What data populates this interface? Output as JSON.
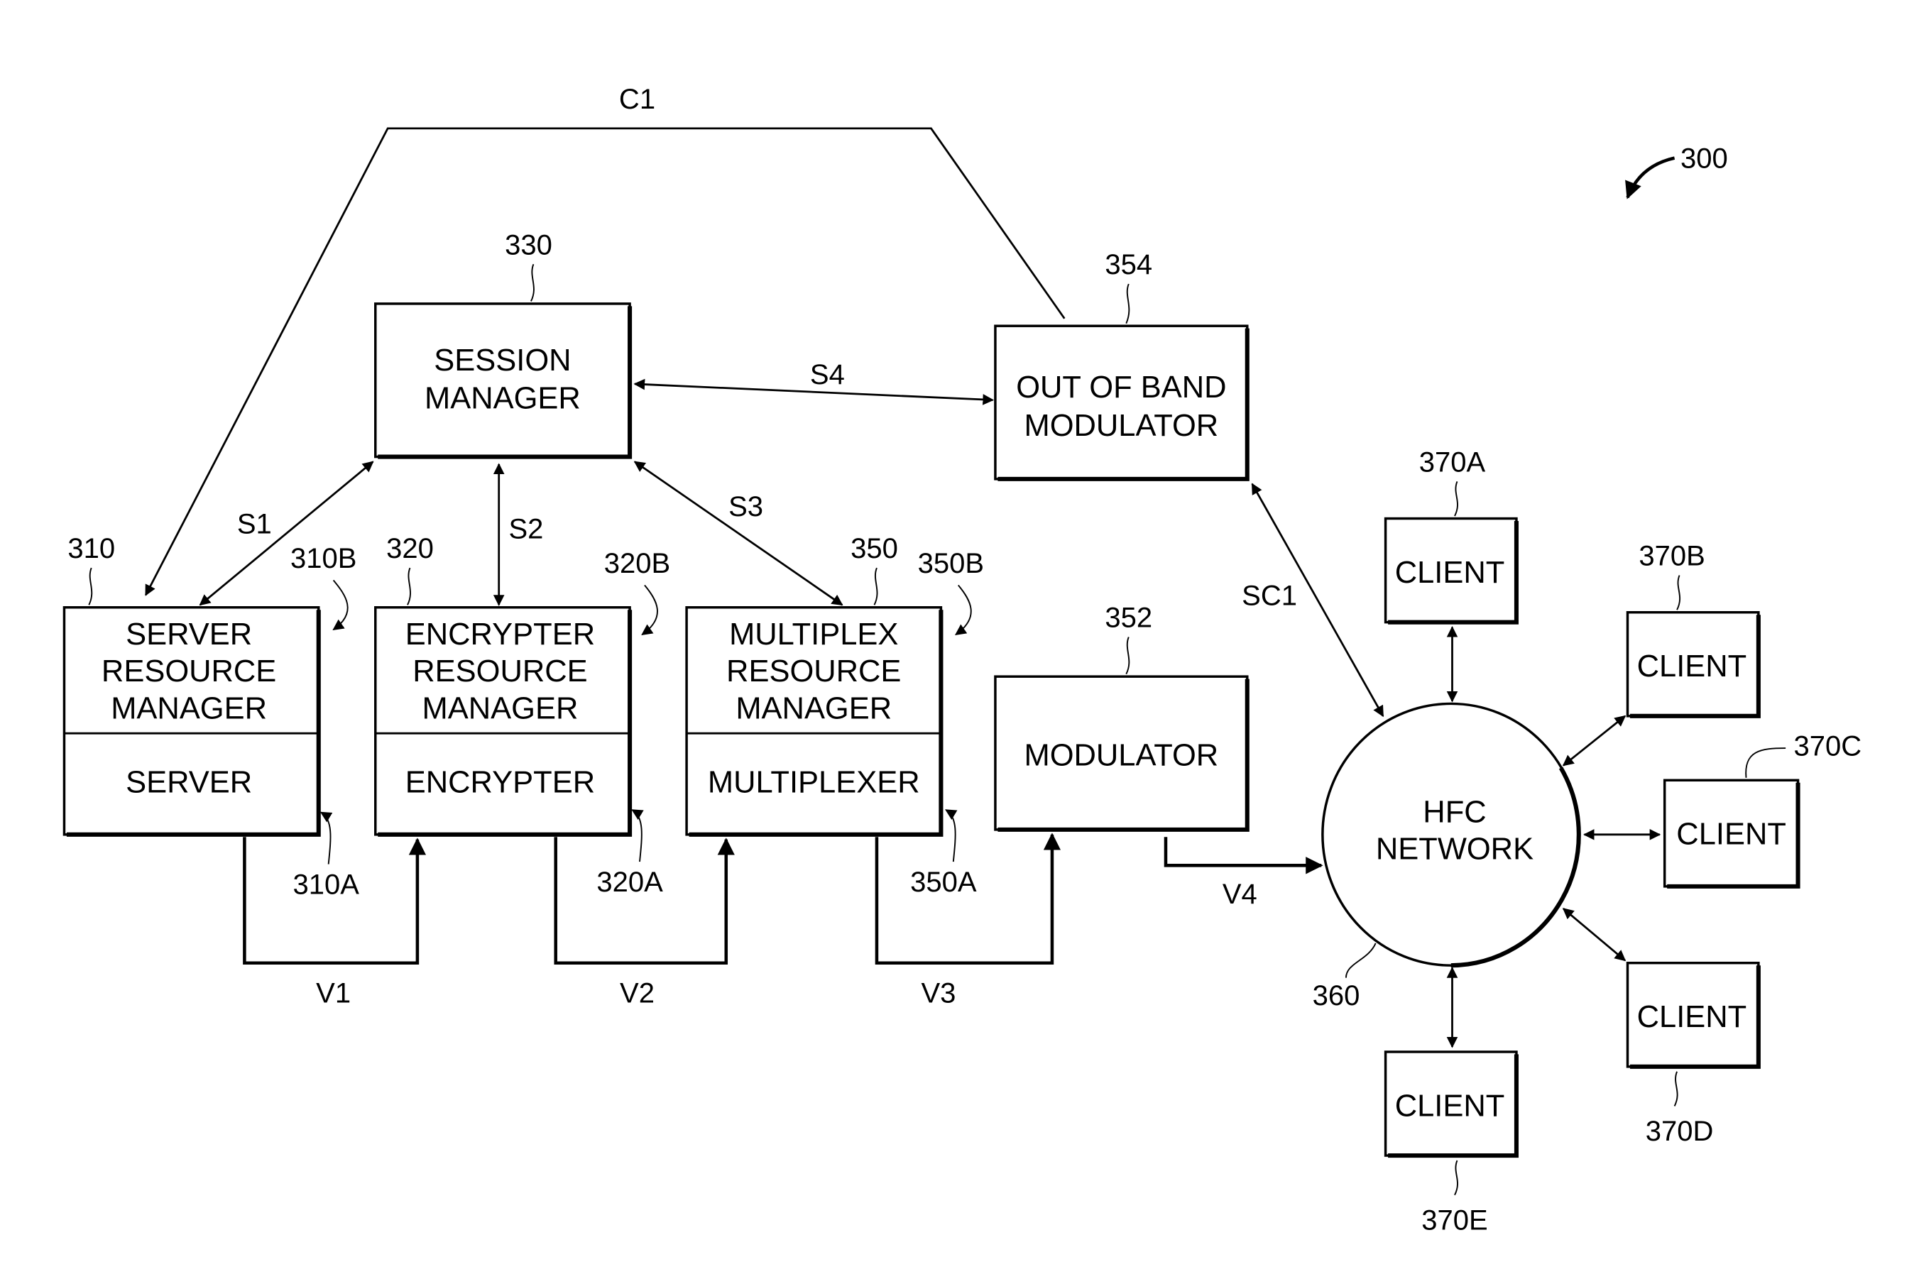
{
  "figure": {
    "ref": "300",
    "connections": {
      "c1": "C1",
      "s1": "S1",
      "s2": "S2",
      "s3": "S3",
      "s4": "S4",
      "sc1": "SC1",
      "v1": "V1",
      "v2": "V2",
      "v3": "V3",
      "v4": "V4"
    },
    "session_manager": {
      "ref": "330",
      "line1": "SESSION",
      "line2": "MANAGER"
    },
    "oob_modulator": {
      "ref": "354",
      "line1": "OUT OF BAND",
      "line2": "MODULATOR"
    },
    "server_block": {
      "ref": "310",
      "ref_b": "310B",
      "ref_a": "310A",
      "top1": "SERVER",
      "top2": "RESOURCE",
      "top3": "MANAGER",
      "bottom": "SERVER"
    },
    "encrypter_block": {
      "ref": "320",
      "ref_b": "320B",
      "ref_a": "320A",
      "top1": "ENCRYPTER",
      "top2": "RESOURCE",
      "top3": "MANAGER",
      "bottom": "ENCRYPTER"
    },
    "multiplex_block": {
      "ref": "350",
      "ref_b": "350B",
      "ref_a": "350A",
      "top1": "MULTIPLEX",
      "top2": "RESOURCE",
      "top3": "MANAGER",
      "bottom": "MULTIPLEXER"
    },
    "modulator": {
      "ref": "352",
      "label": "MODULATOR"
    },
    "hfc_network": {
      "ref": "360",
      "line1": "HFC",
      "line2": "NETWORK"
    },
    "clients": [
      {
        "ref": "370A",
        "label": "CLIENT"
      },
      {
        "ref": "370B",
        "label": "CLIENT"
      },
      {
        "ref": "370C",
        "label": "CLIENT"
      },
      {
        "ref": "370D",
        "label": "CLIENT"
      },
      {
        "ref": "370E",
        "label": "CLIENT"
      }
    ]
  }
}
